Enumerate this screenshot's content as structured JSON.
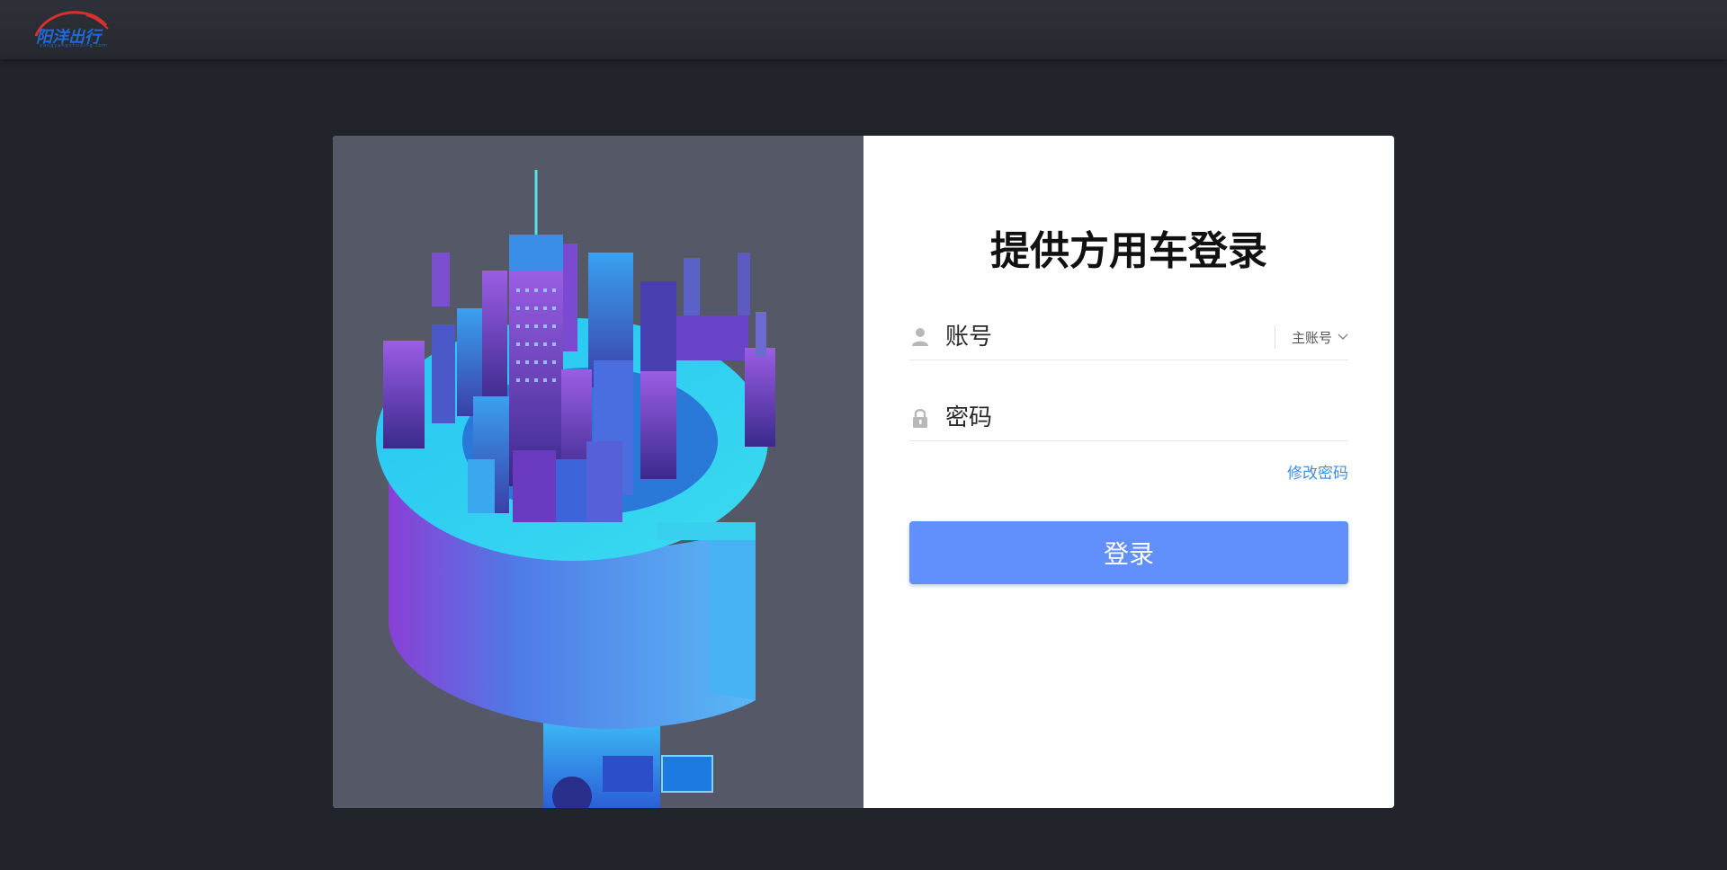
{
  "header": {
    "logo_text": "阳洋出行",
    "logo_subtext": "yangyangchuxing.com"
  },
  "login": {
    "title": "提供方用车登录",
    "account_placeholder": "账号",
    "account_type_label": "主账号",
    "password_placeholder": "密码",
    "forgot_password_label": "修改密码",
    "submit_label": "登录"
  },
  "icons": {
    "account": "user-icon",
    "password": "lock-icon",
    "account_type": "chevron-down-icon"
  },
  "colors": {
    "page_background": "#22242c",
    "illustration_background": "#555867",
    "primary_button": "#6190fc",
    "link": "#3f8ee8",
    "logo": "#1e6ad8",
    "logo_accent": "#d9302f"
  }
}
